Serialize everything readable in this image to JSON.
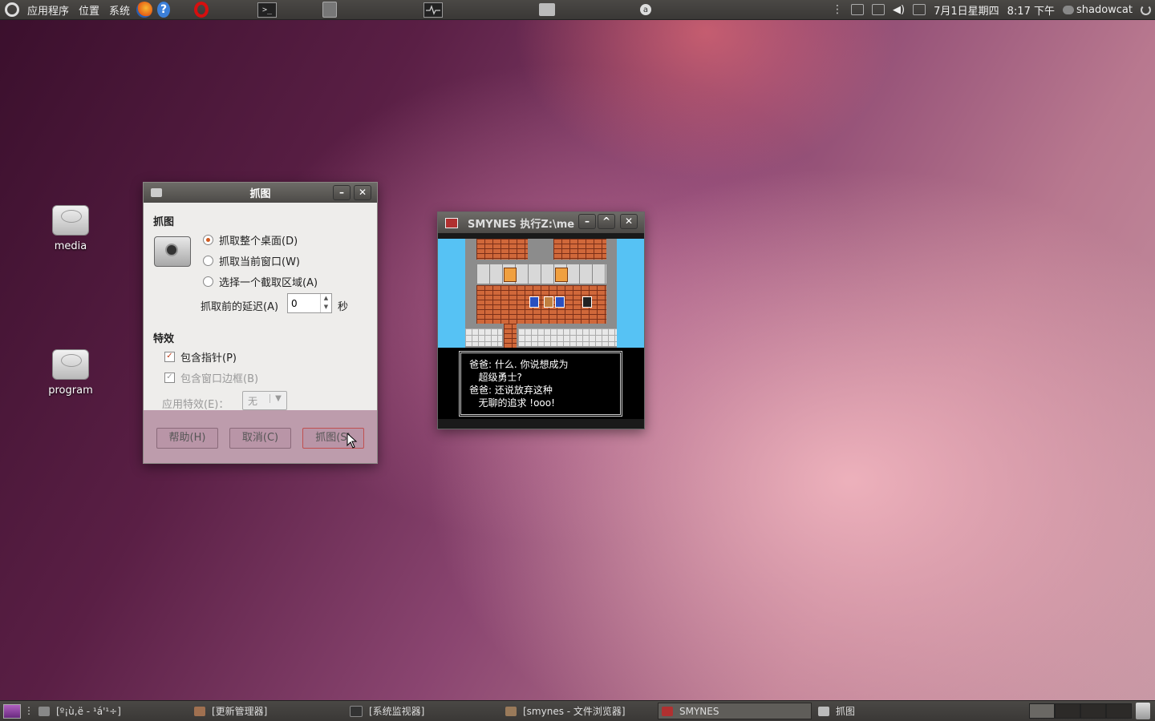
{
  "top_panel": {
    "menus": [
      "应用程序",
      "位置",
      "系统"
    ],
    "launchers": [
      "firefox-icon",
      "help-icon",
      "opera-icon",
      "terminal-icon",
      "disk-icon",
      "system-monitor-icon",
      "screenshot-icon",
      "circle-a-icon"
    ],
    "datetime": "7月1日星期四",
    "time": "8:17 下午",
    "user": "shadowcat"
  },
  "desktop_icons": [
    {
      "label": "media"
    },
    {
      "label": "program"
    }
  ],
  "screenshot_dialog": {
    "title": "抓图",
    "section_grab": "抓图",
    "opt_desktop": "抓取整个桌面(D)",
    "opt_window": "抓取当前窗口(W)",
    "opt_area": "选择一个截取区域(A)",
    "delay_label": "抓取前的延迟(A)",
    "delay_value": "0",
    "delay_unit": "秒",
    "section_effects": "特效",
    "include_pointer": "包含指针(P)",
    "include_border": "包含窗口边框(B)",
    "apply_effect_label": "应用特效(E)：",
    "apply_effect_value": "无",
    "help_button": "帮助(H)",
    "cancel_button": "取消(C)",
    "grab_button": "抓图(S)"
  },
  "nes_window": {
    "title": "SMYNES 执行Z:\\me",
    "dialog_text": "爸爸: 什么. 你说想成为\n   超级勇士?\n爸爸: 还说放弃这种\n   无聊的追求 !ooo!"
  },
  "bottom_panel": {
    "tasks": [
      {
        "label": "[º¡ù,ë - ¹á'¹÷]"
      },
      {
        "label": "[更新管理器]"
      },
      {
        "label": "[系统监视器]"
      },
      {
        "label": "[smynes - 文件浏览器]"
      },
      {
        "label": "SMYNES"
      },
      {
        "label": "抓图"
      }
    ]
  }
}
